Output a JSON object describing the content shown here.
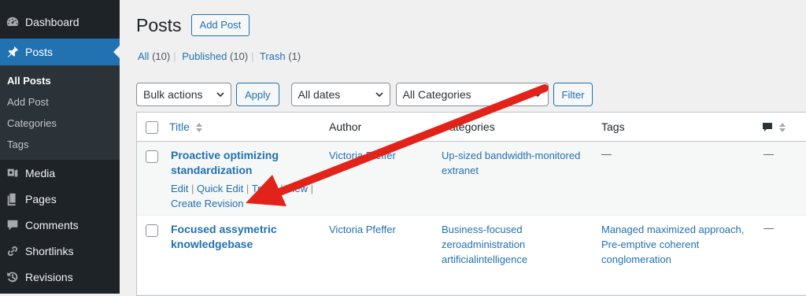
{
  "sidebar": {
    "items": [
      {
        "label": "Dashboard",
        "icon": "dashboard-icon"
      },
      {
        "label": "Posts",
        "icon": "pin-icon",
        "current": true
      },
      {
        "label": "Media",
        "icon": "media-icon"
      },
      {
        "label": "Pages",
        "icon": "pages-icon"
      },
      {
        "label": "Comments",
        "icon": "comments-icon"
      },
      {
        "label": "Shortlinks",
        "icon": "link-icon"
      },
      {
        "label": "Revisions",
        "icon": "revisions-icon"
      }
    ],
    "submenu": [
      "All Posts",
      "Add Post",
      "Categories",
      "Tags"
    ]
  },
  "header": {
    "title": "Posts",
    "add_button": "Add Post"
  },
  "views": {
    "all": "All",
    "all_count": "(10)",
    "published": "Published",
    "published_count": "(10)",
    "trash": "Trash",
    "trash_count": "(1)",
    "separator": "|"
  },
  "filters": {
    "bulk": "Bulk actions",
    "apply": "Apply",
    "dates": "All dates",
    "categories": "All Categories",
    "filter": "Filter"
  },
  "table": {
    "headers": {
      "title": "Title",
      "author": "Author",
      "categories": "Categories",
      "tags": "Tags"
    },
    "rows": [
      {
        "title_line1": "Proactive optimizing",
        "title_line2": "standardization",
        "author": "Victoria Pfeffer",
        "categories_line1": "Up-sized bandwidth-monitored",
        "categories_line2": "extranet",
        "tags": "—",
        "comments": "—",
        "actions": {
          "edit": "Edit",
          "quick_edit": "Quick Edit",
          "trash": "Trash",
          "view": "View",
          "revision": "Create Revision",
          "sep": "|"
        }
      },
      {
        "title_line1": "Focused assymetric",
        "title_line2": "knowledgebase",
        "author": "Victoria Pfeffer",
        "categories_line1": "Business-focused",
        "categories_line2": "zeroadministration",
        "categories_line3": "artificialintelligence",
        "tags_line1": "Managed maximized approach,",
        "tags_line2": "Pre-emptive coherent",
        "tags_line3": "conglomeration",
        "comments": "—"
      }
    ]
  },
  "colors": {
    "accent": "#2271b1",
    "sidebar_bg": "#1d2327",
    "arrow": "#e2231a"
  }
}
